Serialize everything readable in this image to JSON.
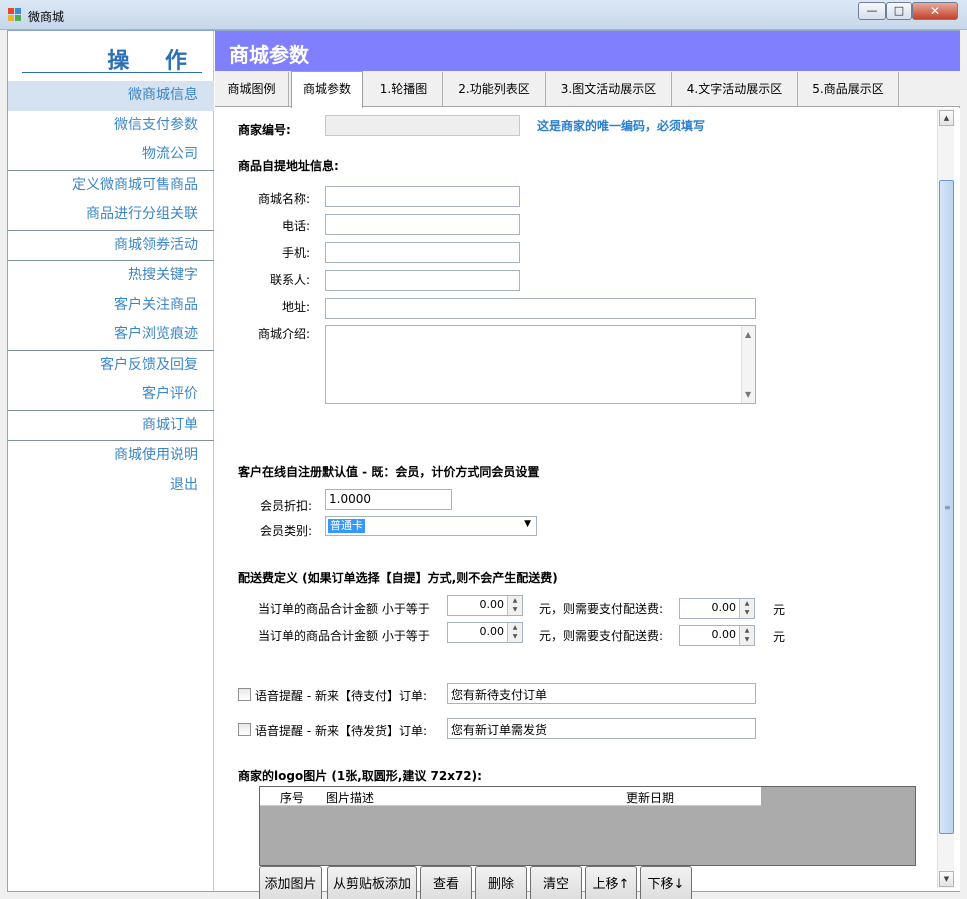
{
  "window": {
    "title": "微商城",
    "min": "—",
    "max": "□",
    "close": "✕"
  },
  "sidebar": {
    "heading": "操 作",
    "items": [
      {
        "label": "微商城信息"
      },
      {
        "label": "微信支付参数"
      },
      {
        "label": "物流公司"
      },
      {
        "label": "定义微商城可售商品"
      },
      {
        "label": "商品进行分组关联"
      },
      {
        "label": "商城领券活动"
      },
      {
        "label": "热搜关键字"
      },
      {
        "label": "客户关注商品"
      },
      {
        "label": "客户浏览痕迹"
      },
      {
        "label": "客户反馈及回复"
      },
      {
        "label": "客户评价"
      },
      {
        "label": "商城订单"
      },
      {
        "label": "商城使用说明"
      },
      {
        "label": "退出"
      }
    ]
  },
  "header": {
    "title": "商城参数"
  },
  "tabs": [
    "商城图例",
    "商城参数",
    "1.轮播图",
    "2.功能列表区",
    "3.图文活动展示区",
    "4.文字活动展示区",
    "5.商品展示区"
  ],
  "form": {
    "merchant_no_label": "商家编号:",
    "merchant_no_hint": "这是商家的唯一编码，必须填写",
    "pickup_heading": "商品自提地址信息:",
    "shop_name_label": "商城名称:",
    "phone_label": "电话:",
    "mobile_label": "手机:",
    "contact_label": "联系人:",
    "address_label": "地址:",
    "intro_label": "商城介绍:",
    "register_heading": "客户在线自注册默认值 - 既：会员，计价方式同会员设置",
    "discount_label": "会员折扣:",
    "discount_value": "1.0000",
    "member_type_label": "会员类别:",
    "member_type_value": "普通卡",
    "delivery_heading": "配送费定义 (如果订单选择【自提】方式,则不会产生配送费)",
    "delivery_rows": [
      {
        "prefix": "当订单的商品合计金额 小于等于",
        "amount": "0.00",
        "mid": "元，则需要支付配送费:",
        "fee": "0.00",
        "unit": "元"
      },
      {
        "prefix": "当订单的商品合计金额 小于等于",
        "amount": "0.00",
        "mid": "元，则需要支付配送费:",
        "fee": "0.00",
        "unit": "元"
      }
    ],
    "voice_pay_label": "语音提醒 - 新来【待支付】订单:",
    "voice_pay_value": "您有新待支付订单",
    "voice_ship_label": "语音提醒 - 新来【待发货】订单:",
    "voice_ship_value": "您有新订单需发货",
    "logo_heading": "商家的logo图片 (1张,取圆形,建议 72x72):",
    "grid_cols": [
      "序号",
      "图片描述",
      "更新日期"
    ],
    "buttons": [
      "添加图片",
      "从剪贴板添加",
      "查看",
      "删除",
      "清空",
      "上移↑",
      "下移↓"
    ]
  }
}
